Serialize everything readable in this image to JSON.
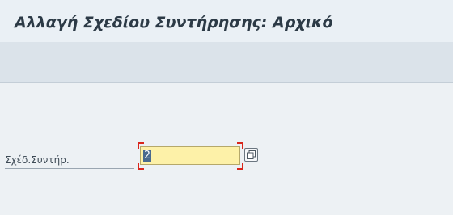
{
  "window": {
    "title": "Αλλαγή Σχεδίου Συντήρησης: Αρχικό"
  },
  "form": {
    "plan_label": "Σχέδ.Συντήρ.",
    "plan_value": "2"
  },
  "icons": {
    "value_help": "value-help-icon"
  },
  "colors": {
    "input_background": "#fdf1a8",
    "required_marker": "#d9261c",
    "title_text": "#2c3a46"
  }
}
